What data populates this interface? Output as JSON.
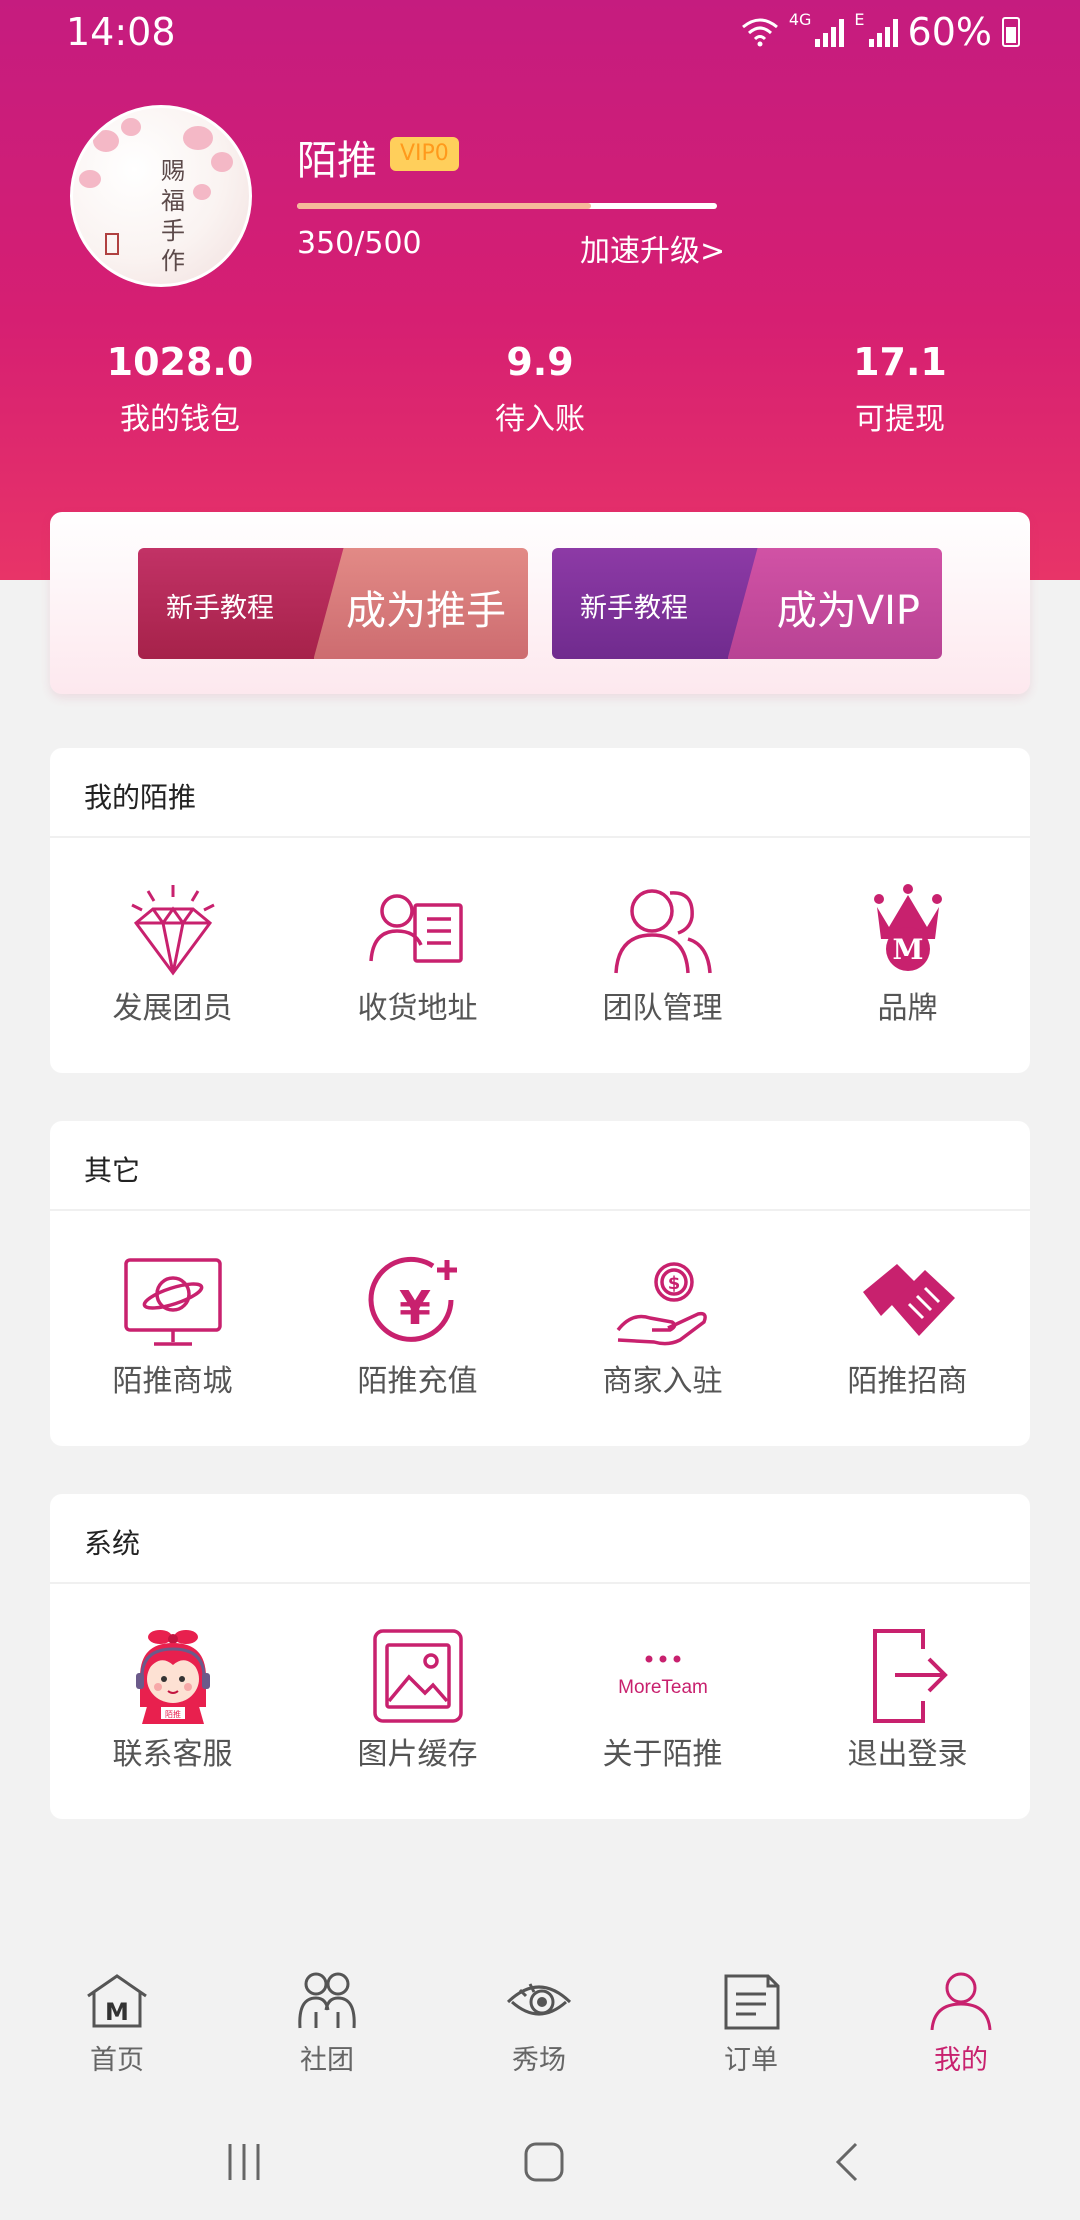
{
  "status_bar": {
    "time": "14:08",
    "network": "4G",
    "network_e": "E",
    "battery": "60%"
  },
  "profile": {
    "username": "陌推",
    "vip_badge": "VIP0",
    "avatar_text": "赐福手作",
    "progress_text": "350/500",
    "progress_fraction": 0.7,
    "upgrade_link": "加速升级>"
  },
  "stats": [
    {
      "value": "1028.0",
      "label": "我的钱包"
    },
    {
      "value": "9.9",
      "label": "待入账"
    },
    {
      "value": "17.1",
      "label": "可提现"
    }
  ],
  "promo": [
    {
      "small": "新手教程",
      "big": "成为推手"
    },
    {
      "small": "新手教程",
      "big": "成为VIP"
    }
  ],
  "sections": [
    {
      "title": "我的陌推",
      "items": [
        {
          "label": "发展团员",
          "icon": "diamond-icon"
        },
        {
          "label": "收货地址",
          "icon": "address-card-icon"
        },
        {
          "label": "团队管理",
          "icon": "team-icon"
        },
        {
          "label": "品牌",
          "icon": "crown-icon"
        }
      ]
    },
    {
      "title": "其它",
      "items": [
        {
          "label": "陌推商城",
          "icon": "monitor-planet-icon"
        },
        {
          "label": "陌推充值",
          "icon": "yuan-recharge-icon"
        },
        {
          "label": "商家入驻",
          "icon": "hand-coin-icon"
        },
        {
          "label": "陌推招商",
          "icon": "handshake-icon"
        }
      ]
    },
    {
      "title": "系统",
      "items": [
        {
          "label": "联系客服",
          "icon": "customer-service-icon",
          "icon_text": "陌推"
        },
        {
          "label": "图片缓存",
          "icon": "image-icon"
        },
        {
          "label": "关于陌推",
          "icon": "moreteam-logo-icon",
          "icon_text": "MoreTeam"
        },
        {
          "label": "退出登录",
          "icon": "logout-icon"
        }
      ]
    }
  ],
  "tabs": [
    {
      "label": "首页",
      "icon": "home-icon",
      "active": false
    },
    {
      "label": "社团",
      "icon": "group-icon",
      "active": false
    },
    {
      "label": "秀场",
      "icon": "eye-icon",
      "active": false
    },
    {
      "label": "订单",
      "icon": "order-icon",
      "active": false
    },
    {
      "label": "我的",
      "icon": "user-icon",
      "active": true
    }
  ],
  "colors": {
    "primary": "#c8216e",
    "header_top": "#c51c7f",
    "header_bottom": "#e83468",
    "badge": "#ffcf5b"
  }
}
